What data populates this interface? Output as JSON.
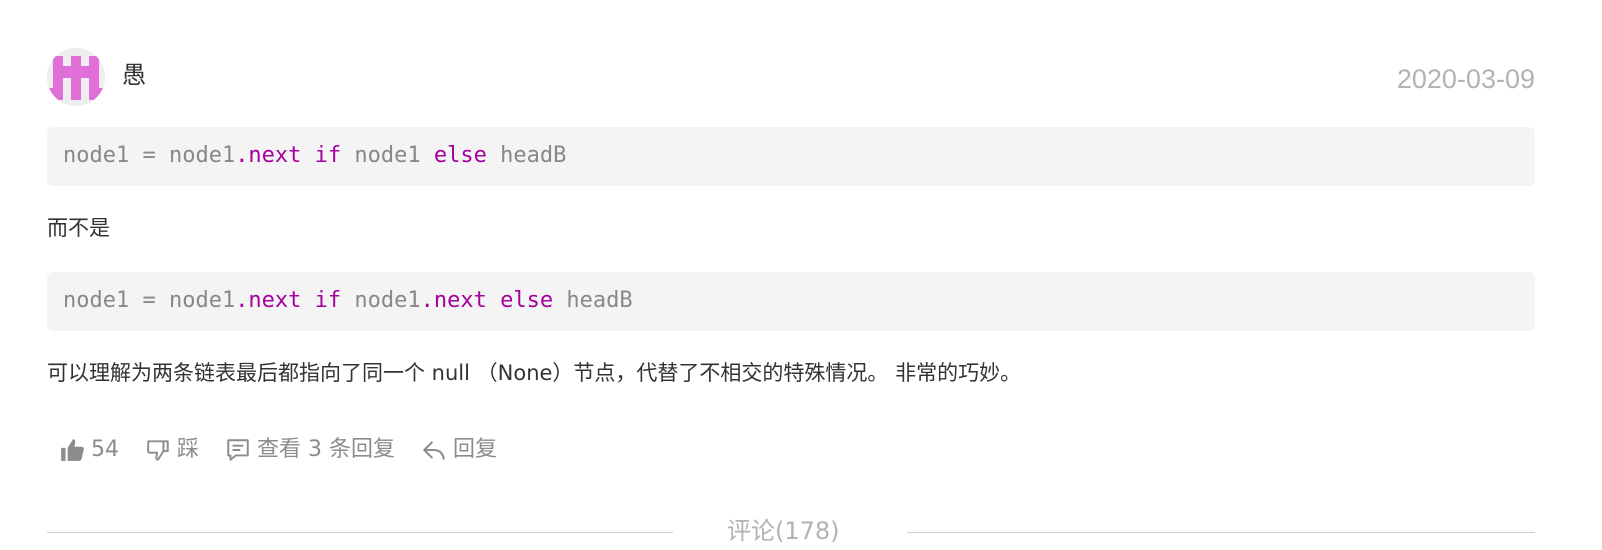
{
  "comment": {
    "author": "愚",
    "date": "2020-03-09",
    "code_blocks": [
      {
        "tokens": [
          {
            "text": "node1 = node1",
            "kind": "plain"
          },
          {
            "text": ".next",
            "kind": "kw"
          },
          {
            "text": " ",
            "kind": "plain"
          },
          {
            "text": "if",
            "kind": "kw"
          },
          {
            "text": " node1 ",
            "kind": "plain"
          },
          {
            "text": "else",
            "kind": "kw"
          },
          {
            "text": " headB",
            "kind": "plain"
          }
        ]
      },
      {
        "tokens": [
          {
            "text": "node1 = node1",
            "kind": "plain"
          },
          {
            "text": ".next",
            "kind": "kw"
          },
          {
            "text": " ",
            "kind": "plain"
          },
          {
            "text": "if",
            "kind": "kw"
          },
          {
            "text": " node1",
            "kind": "plain"
          },
          {
            "text": ".next",
            "kind": "kw"
          },
          {
            "text": " ",
            "kind": "plain"
          },
          {
            "text": "else",
            "kind": "kw"
          },
          {
            "text": " headB",
            "kind": "plain"
          }
        ]
      }
    ],
    "text_between": "而不是",
    "text_after": "可以理解为两条链表最后都指向了同一个 null （None）节点，代替了不相交的特殊情况。 非常的巧妙。",
    "actions": {
      "like_count": "54",
      "dislike_label": "踩",
      "view_replies_label": "查看 3 条回复",
      "reply_label": "回复"
    }
  },
  "comments_divider": "评论(178)",
  "colors": {
    "keyword": "#a6009e",
    "code_plain": "#888888",
    "code_bg": "#f4f4f4",
    "avatar_pink": "#e070d8"
  },
  "icons": {
    "like": "thumbs-up-icon",
    "dislike": "thumbs-down-icon",
    "replies": "comment-icon",
    "reply": "reply-arrow-icon"
  }
}
